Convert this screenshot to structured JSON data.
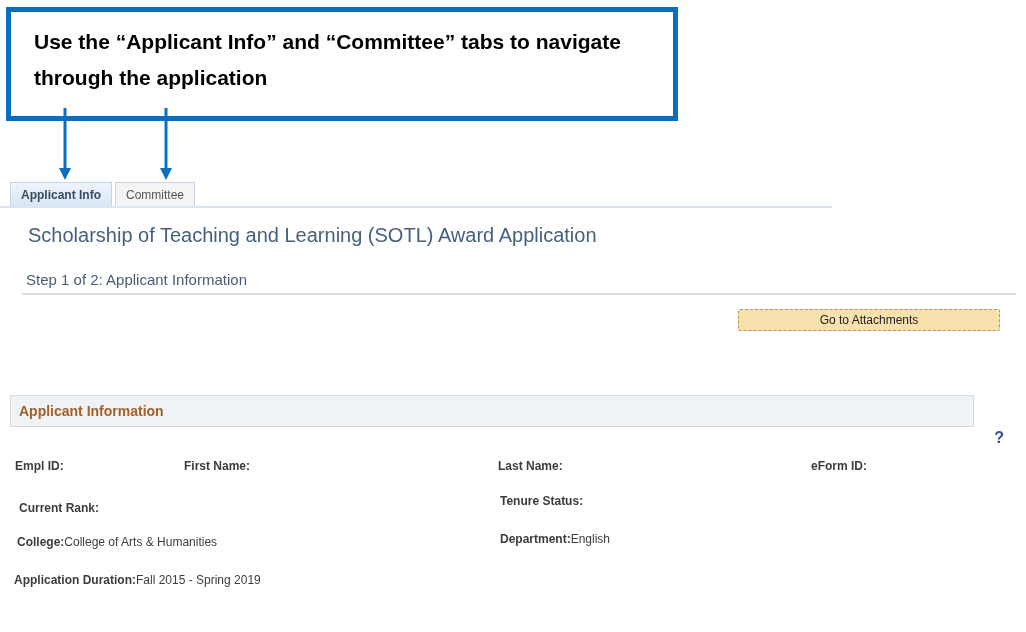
{
  "callout": {
    "text": "Use the “Applicant Info” and “Committee” tabs to navigate through the application"
  },
  "tabs": [
    {
      "label": "Applicant Info",
      "selected": true
    },
    {
      "label": "Committee",
      "selected": false
    }
  ],
  "page_title": "Scholarship of Teaching and Learning (SOTL) Award Application",
  "step": "Step 1 of 2: Applicant Information",
  "button": "Go to Attachments",
  "section": {
    "title": "Applicant Information",
    "help": "?"
  },
  "fields": [
    {
      "label": "Empl ID:"
    },
    {
      "label": "First Name:"
    },
    {
      "label": "Last Name:"
    },
    {
      "label": "eForm ID:"
    },
    {
      "label": "Current Rank:"
    },
    {
      "label": "Tenure Status:"
    },
    {
      "label": "College:",
      "value": "College of Arts & Humanities"
    },
    {
      "label": "Department:",
      "value": "English"
    },
    {
      "label": "Application Duration:",
      "value": "Fall 2015 - Spring 2019"
    }
  ]
}
